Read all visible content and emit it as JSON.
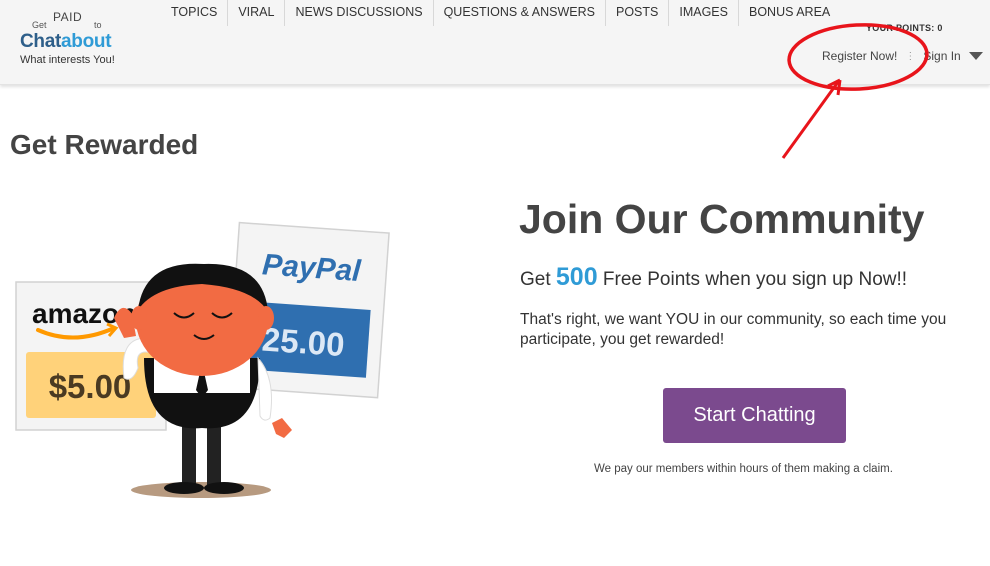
{
  "logo": {
    "get": "Get",
    "paid": "PAID",
    "to": "to",
    "brand_a": "Chat",
    "brand_b": "about",
    "tagline": "What interests You!"
  },
  "nav": {
    "items": [
      "TOPICS",
      "VIRAL",
      "NEWS DISCUSSIONS",
      "QUESTIONS & ANSWERS",
      "POSTS",
      "IMAGES",
      "BONUS AREA"
    ]
  },
  "user": {
    "points_label": "YOUR POINTS: 0",
    "register_label": "Register Now!",
    "separator": "⋮",
    "signin_label": "Sign In"
  },
  "page": {
    "title_plain": "Get",
    "title_bold": "Rewarded"
  },
  "illustration": {
    "amazon_brand": "amazon",
    "amazon_amount": "$5.00",
    "paypal_brand": "PayPal",
    "paypal_amount": "25.00"
  },
  "hero": {
    "title_plain": "Join Our",
    "title_bold": "Community",
    "points_prefix": "Get",
    "points_value": "500",
    "points_suffix": "Free Points when you sign up Now!!",
    "description": "That's right, we want YOU in our community, so each time you participate, you get rewarded!",
    "cta_label": "Start Chatting",
    "footnote": "We pay our members within hours of them making a claim."
  },
  "colors": {
    "header_bg": "#f5f5f5",
    "brand_dark": "#2e5f8a",
    "brand_light": "#2f9bd6",
    "cta_purple": "#7b4a8e",
    "annotation_red": "#e8141b",
    "amazon_orange": "#ff9900",
    "paypal_blue": "#2f6fb0"
  }
}
